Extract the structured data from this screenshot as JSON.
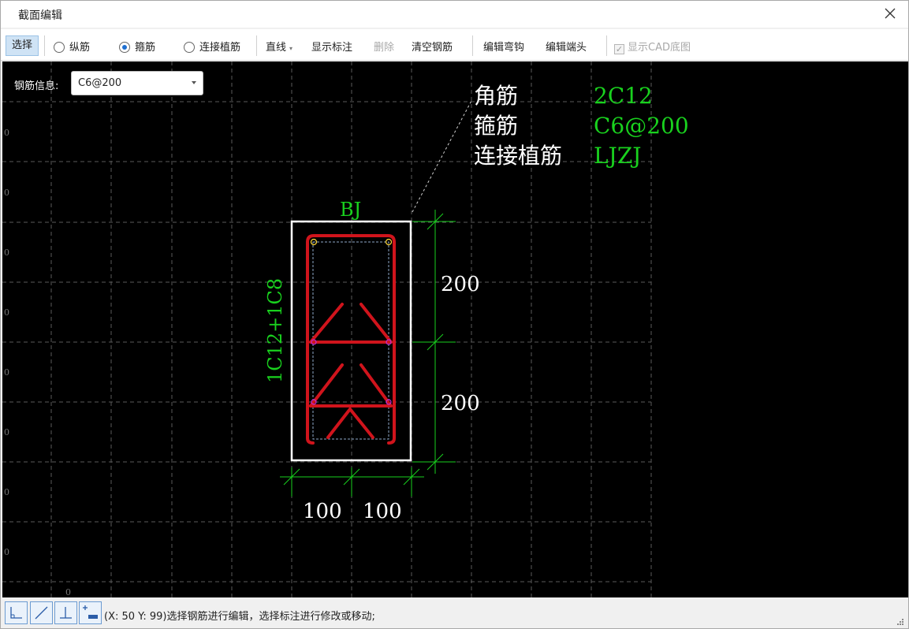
{
  "window": {
    "title": "截面编辑"
  },
  "toolbar": {
    "select": "选择",
    "longitudinal": "纵筋",
    "stirrup": "箍筋",
    "connect": "连接植筋",
    "line_mode": "直线",
    "show_annotation": "显示标注",
    "delete": "删除",
    "clear_rebar": "清空钢筋",
    "edit_hook": "编辑弯钩",
    "edit_end": "编辑端头",
    "show_cad": "显示CAD底图",
    "selected_radio": "箍筋"
  },
  "rebar_info": {
    "label": "钢筋信息:",
    "value": "C6@200"
  },
  "drawing": {
    "legend": [
      {
        "name": "角筋",
        "value": "2C12"
      },
      {
        "name": "箍筋",
        "value": "C6@200"
      },
      {
        "name": "连接植筋",
        "value": "LJZJ"
      }
    ],
    "section_label": "BJ",
    "side_label": "1C12+1C8",
    "dim_right": [
      "200",
      "200"
    ],
    "dim_bottom": [
      "100",
      "100"
    ],
    "axis_ticks": [
      "0",
      "0",
      "0",
      "0",
      "0",
      "0",
      "0",
      "0",
      "0"
    ],
    "colors": {
      "rebar": "#d0141c",
      "dimension": "#19d11e",
      "outline": "#ffffff",
      "grid": "#555555"
    }
  },
  "statusbar": {
    "text": "(X: 50 Y: 99)选择钢筋进行编辑，选择标注进行修改或移动;"
  }
}
